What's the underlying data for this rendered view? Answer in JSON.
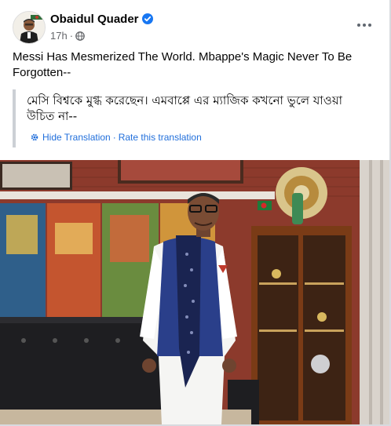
{
  "post": {
    "author": "Obaidul Quader",
    "time": "17h",
    "separator": "·",
    "visibility_icon": "globe-icon",
    "verified_icon": "verified-badge-icon",
    "more_icon": "more-options-icon",
    "caption": "Messi Has Mesmerized The World. Mbappe's Magic Never To Be Forgotten--",
    "translation": {
      "text": "মেসি বিশ্বকে মুগ্ধ করেছেন। এমবাপ্পে এর ম্যাজিক কখনো ভুলে যাওয়া উচিত না--",
      "hide_label": "Hide Translation",
      "dot": "·",
      "rate_label": "Rate this translation"
    }
  },
  "colors": {
    "link": "#216fdb",
    "verified": "#1877f2",
    "meta_gray": "#65676b",
    "quote_bar": "#ccd0d5"
  }
}
